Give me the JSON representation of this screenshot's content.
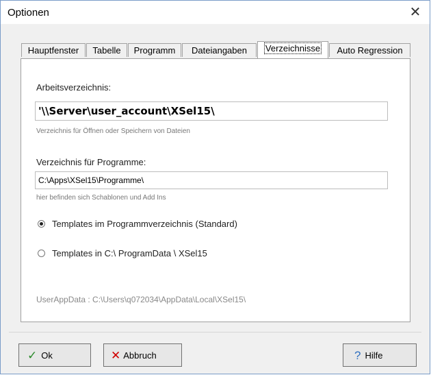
{
  "window": {
    "title": "Optionen",
    "close_glyph": "✕"
  },
  "tabs": [
    {
      "label": "Hauptfenster"
    },
    {
      "label": "Tabelle"
    },
    {
      "label": "Programm"
    },
    {
      "label": "Dateiangaben"
    },
    {
      "label": "Verzeichnisse",
      "active": true
    },
    {
      "label": "Auto Regression"
    }
  ],
  "working_dir": {
    "label": "Arbeitsverzeichnis:",
    "value": "'\\\\Server\\user_account\\XSel15\\",
    "hint": "Verzeichnis für Öffnen oder Speichern von Dateien"
  },
  "program_dir": {
    "label": "Verzeichnis für Programme:",
    "value": "C:\\Apps\\XSel15\\Programme\\",
    "hint": "hier befinden sich Schablonen und Add Ins"
  },
  "templates": {
    "option_standard": "Templates im Programmverzeichnis (Standard)",
    "option_programdata": "Templates in C:\\ ProgramData \\ XSel15",
    "selected": "option_standard"
  },
  "userappdata": {
    "text": "UserAppData :  C:\\Users\\q072034\\AppData\\Local\\XSel15\\"
  },
  "buttons": {
    "ok": {
      "label": "Ok",
      "icon": "checkmark-icon",
      "color": "#2a8a2a"
    },
    "cancel": {
      "label": "Abbruch",
      "icon": "x-icon",
      "color": "#d00000"
    },
    "help": {
      "label": "Hilfe",
      "icon": "question-icon",
      "color": "#3070c0"
    }
  }
}
